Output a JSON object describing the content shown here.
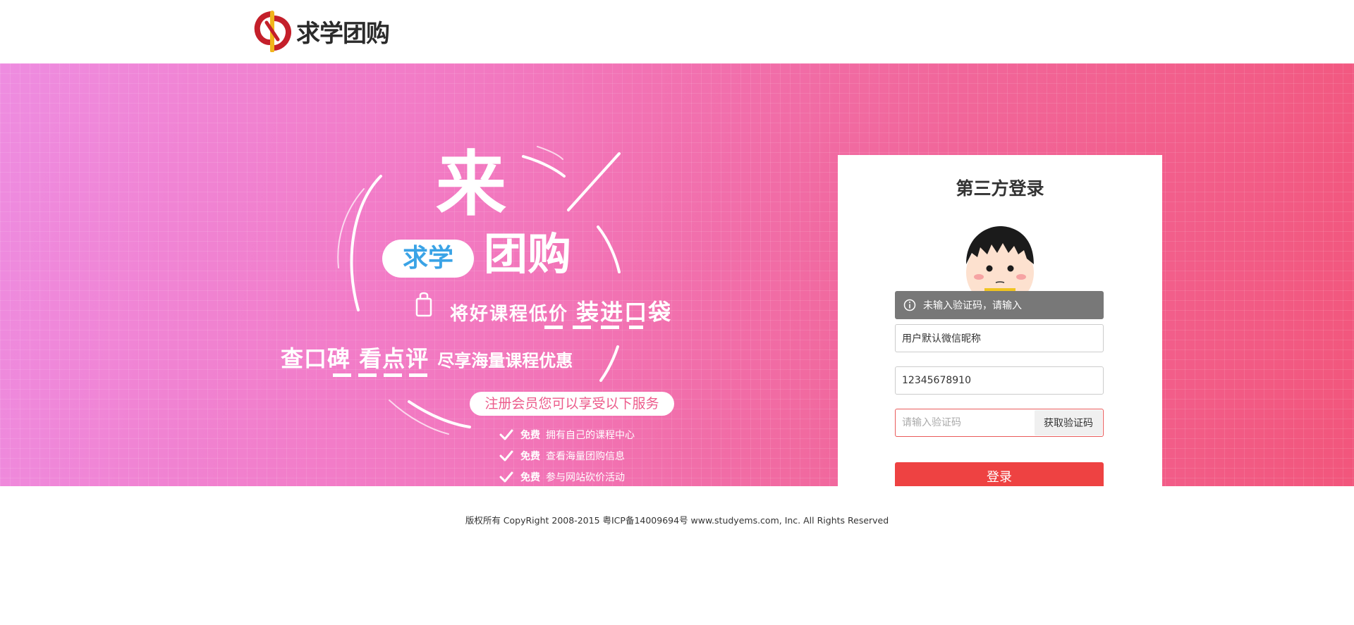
{
  "header": {
    "logo_text": "求学团购",
    "colors": {
      "logo_red": "#c41f2a",
      "logo_yellow": "#f1b51c"
    }
  },
  "banner": {
    "colors": {
      "gradient_start": "#ee8ce0",
      "gradient_end": "#f2567c",
      "blue": "#3aa3e6"
    },
    "headline_lai": "来",
    "pill_qiuxue": "求学",
    "tuangou": "团购",
    "line2_a": "将好课程低价",
    "line2_b": "装进口袋",
    "line3_a": "查口碑",
    "line3_b": "看点评",
    "line3_c": "尽享海量课程优惠",
    "register_pill": "注册会员您可以享受以下服务",
    "benefits": [
      {
        "free": "免费",
        "text": "拥有自己的课程中心"
      },
      {
        "free": "免费",
        "text": "查看海量团购信息"
      },
      {
        "free": "免费",
        "text": "参与网站砍价活动"
      }
    ]
  },
  "login": {
    "title": "第三方登录",
    "toast": "未输入验证码，请输入",
    "nickname_value": "用户默认微信昵称",
    "phone_value": "12345678910",
    "code_placeholder": "请输入验证码",
    "get_code_label": "获取验证码",
    "submit_label": "登录",
    "colors": {
      "primary": "#ee4242",
      "toast_bg": "#787878",
      "error_border": "#e95b5b"
    }
  },
  "footer": {
    "copyright": "版权所有 CopyRight 2008-2015 粤ICP备14009694号 www.studyems.com, Inc. All Rights Reserved"
  }
}
